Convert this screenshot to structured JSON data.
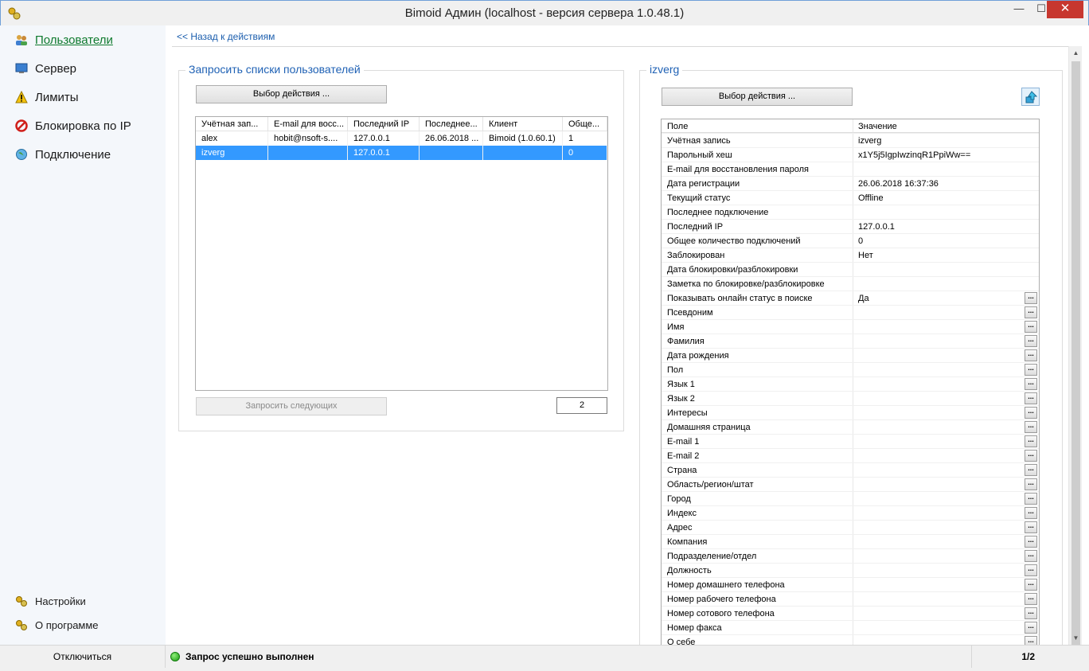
{
  "window": {
    "title": "Bimoid Админ (localhost - версия сервера 1.0.48.1)",
    "close_glyph": "✕",
    "min_glyph": "—",
    "max_glyph": "☐"
  },
  "sidebar": {
    "items": [
      {
        "label": "Пользователи",
        "icon": "users-icon",
        "active": true
      },
      {
        "label": "Сервер",
        "icon": "monitor-icon"
      },
      {
        "label": "Лимиты",
        "icon": "warning-icon"
      },
      {
        "label": "Блокировка по IP",
        "icon": "block-icon"
      },
      {
        "label": "Подключение",
        "icon": "globe-icon"
      }
    ],
    "bottom_items": [
      {
        "label": "Настройки",
        "icon": "gears-icon"
      },
      {
        "label": "О программе",
        "icon": "gears-icon"
      }
    ]
  },
  "main": {
    "back_link": "<< Назад к действиям",
    "left_group": {
      "title": "Запросить списки пользователей",
      "action_button": "Выбор действия ...",
      "columns": [
        "Учётная зап...",
        "E-mail для восс...",
        "Последний IP",
        "Последнее...",
        "Клиент",
        "Обще..."
      ],
      "rows": [
        [
          "alex",
          "hobit@nsoft-s....",
          "127.0.0.1",
          "26.06.2018 ...",
          "Bimoid (1.0.60.1)",
          "1"
        ],
        [
          "izverg",
          "",
          "127.0.0.1",
          "",
          "",
          "0"
        ]
      ],
      "selected_row": 1,
      "next_button": "Запросить следующих",
      "count": "2"
    },
    "right_group": {
      "title": "izverg",
      "action_button": "Выбор действия ...",
      "header": {
        "name": "Поле",
        "value": "Значение"
      },
      "properties": [
        {
          "name": "Учётная запись",
          "value": "izverg",
          "editable": false
        },
        {
          "name": "Парольный хеш",
          "value": "x1Y5j5IgpIwzinqR1PpiWw==",
          "editable": false
        },
        {
          "name": "E-mail для восстановления пароля",
          "value": "",
          "editable": false
        },
        {
          "name": "Дата регистрации",
          "value": "26.06.2018 16:37:36",
          "editable": false
        },
        {
          "name": "Текущий статус",
          "value": "Offline",
          "editable": false
        },
        {
          "name": "Последнее подключение",
          "value": "",
          "editable": false
        },
        {
          "name": "Последний IP",
          "value": "127.0.0.1",
          "editable": false
        },
        {
          "name": "Общее количество подключений",
          "value": "0",
          "editable": false
        },
        {
          "name": "Заблокирован",
          "value": "Нет",
          "editable": false
        },
        {
          "name": "Дата блокировки/разблокировки",
          "value": "",
          "editable": false
        },
        {
          "name": "Заметка по блокировке/разблокировке",
          "value": "",
          "editable": false
        },
        {
          "name": "Показывать онлайн статус в поиске",
          "value": "Да",
          "editable": true
        },
        {
          "name": "Псевдоним",
          "value": "",
          "editable": true
        },
        {
          "name": "Имя",
          "value": "",
          "editable": true
        },
        {
          "name": "Фамилия",
          "value": "",
          "editable": true
        },
        {
          "name": "Дата рождения",
          "value": "",
          "editable": true
        },
        {
          "name": "Пол",
          "value": "",
          "editable": true
        },
        {
          "name": "Язык 1",
          "value": "",
          "editable": true
        },
        {
          "name": "Язык 2",
          "value": "",
          "editable": true
        },
        {
          "name": "Интересы",
          "value": "",
          "editable": true
        },
        {
          "name": "Домашняя страница",
          "value": "",
          "editable": true
        },
        {
          "name": "E-mail 1",
          "value": "",
          "editable": true
        },
        {
          "name": "E-mail 2",
          "value": "",
          "editable": true
        },
        {
          "name": "Страна",
          "value": "",
          "editable": true
        },
        {
          "name": "Область/регион/штат",
          "value": "",
          "editable": true
        },
        {
          "name": "Город",
          "value": "",
          "editable": true
        },
        {
          "name": "Индекс",
          "value": "",
          "editable": true
        },
        {
          "name": "Адрес",
          "value": "",
          "editable": true
        },
        {
          "name": "Компания",
          "value": "",
          "editable": true
        },
        {
          "name": "Подразделение/отдел",
          "value": "",
          "editable": true
        },
        {
          "name": "Должность",
          "value": "",
          "editable": true
        },
        {
          "name": "Номер домашнего телефона",
          "value": "",
          "editable": true
        },
        {
          "name": "Номер рабочего телефона",
          "value": "",
          "editable": true
        },
        {
          "name": "Номер сотового телефона",
          "value": "",
          "editable": true
        },
        {
          "name": "Номер факса",
          "value": "",
          "editable": true
        },
        {
          "name": "О себе",
          "value": "",
          "editable": true
        }
      ],
      "ellipsis_label": "..."
    }
  },
  "statusbar": {
    "disconnect": "Отключиться",
    "status_text": "Запрос успешно выполнен",
    "page": "1/2"
  },
  "colors": {
    "accent": "#2062b5",
    "selection": "#3399ff",
    "active_nav": "#0f7a2e",
    "close": "#c7372f"
  }
}
